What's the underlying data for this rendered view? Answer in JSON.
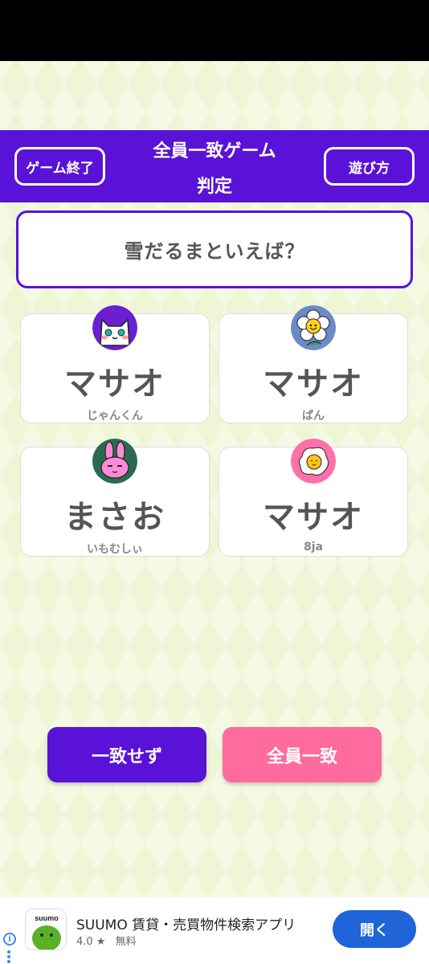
{
  "header": {
    "end_game_label": "ゲーム終了",
    "title_line1": "全員一致ゲーム",
    "title_line2": "判定",
    "how_to_label": "遊び方"
  },
  "question": "雪だるまといえば？",
  "cards": [
    {
      "answer": "マサオ",
      "player": "じゃんくん",
      "avatar": "cat-icon"
    },
    {
      "answer": "マサオ",
      "player": "ぱん",
      "avatar": "flower-icon"
    },
    {
      "answer": "まさお",
      "player": "いもむしぃ",
      "avatar": "rabbit-icon"
    },
    {
      "answer": "マサオ",
      "player": "8ja",
      "avatar": "fried-egg-icon"
    }
  ],
  "actions": {
    "no_match_label": "一致せず",
    "all_match_label": "全員一致"
  },
  "ad": {
    "icon_text": "suumo",
    "title": "SUUMO 賃貸・売買物件検索アプリ",
    "rating": "4.0 ★",
    "price": "無料",
    "open_label": "開く",
    "info_icon": "i"
  },
  "colors": {
    "primary": "#5a12d8",
    "accent_pink": "#ff6b9c",
    "background": "#eef6d6",
    "ad_button": "#1f64d8"
  }
}
